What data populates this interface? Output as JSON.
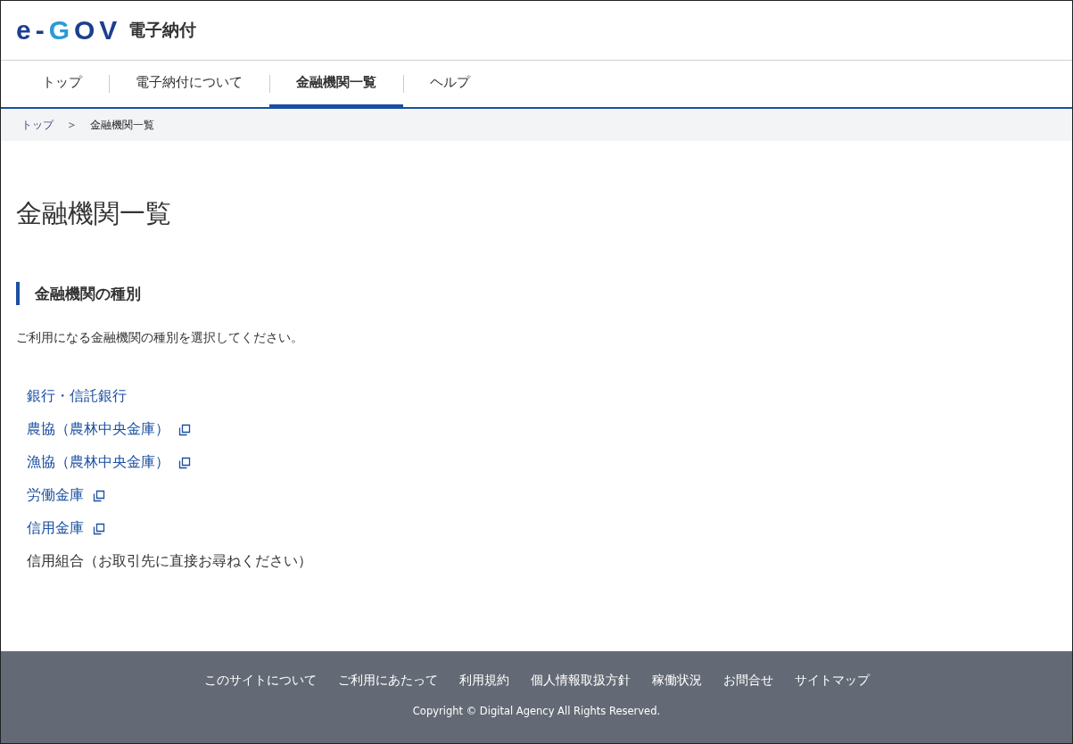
{
  "header": {
    "logo_parts": [
      "e-",
      "G",
      "OV"
    ],
    "site_title": "電子納付"
  },
  "nav_tabs": [
    {
      "label": "トップ",
      "selected": false
    },
    {
      "label": "電子納付について",
      "selected": false
    },
    {
      "label": "金融機関一覧",
      "selected": true
    },
    {
      "label": "ヘルプ",
      "selected": false
    }
  ],
  "breadcrumb": [
    {
      "label": "トップ",
      "kind": "link"
    },
    {
      "label": "＞",
      "kind": "separator"
    },
    {
      "label": "金融機関一覧",
      "kind": "current"
    }
  ],
  "page_title": "金融機関一覧",
  "section": {
    "heading": "金融機関の種別",
    "description": "ご利用になる金融機関の種別を選択してください。",
    "items": [
      {
        "label": "銀行・信託銀行",
        "kind": "link"
      },
      {
        "label": "農協（農林中央金庫）",
        "kind": "external"
      },
      {
        "label": "漁協（農林中央金庫）",
        "kind": "external"
      },
      {
        "label": "労働金庫",
        "kind": "external"
      },
      {
        "label": "信用金庫",
        "kind": "external"
      },
      {
        "label": "信用組合（お取引先に直接お尋ねください）",
        "kind": "text"
      }
    ]
  },
  "footer": {
    "links": [
      "このサイトについて",
      "ご利用にあたって",
      "利用規約",
      "個人情報取扱方針",
      "稼働状況",
      "お問合せ",
      "サイトマップ"
    ],
    "copyright": "Copyright © Digital Agency All Rights Reserved."
  }
}
